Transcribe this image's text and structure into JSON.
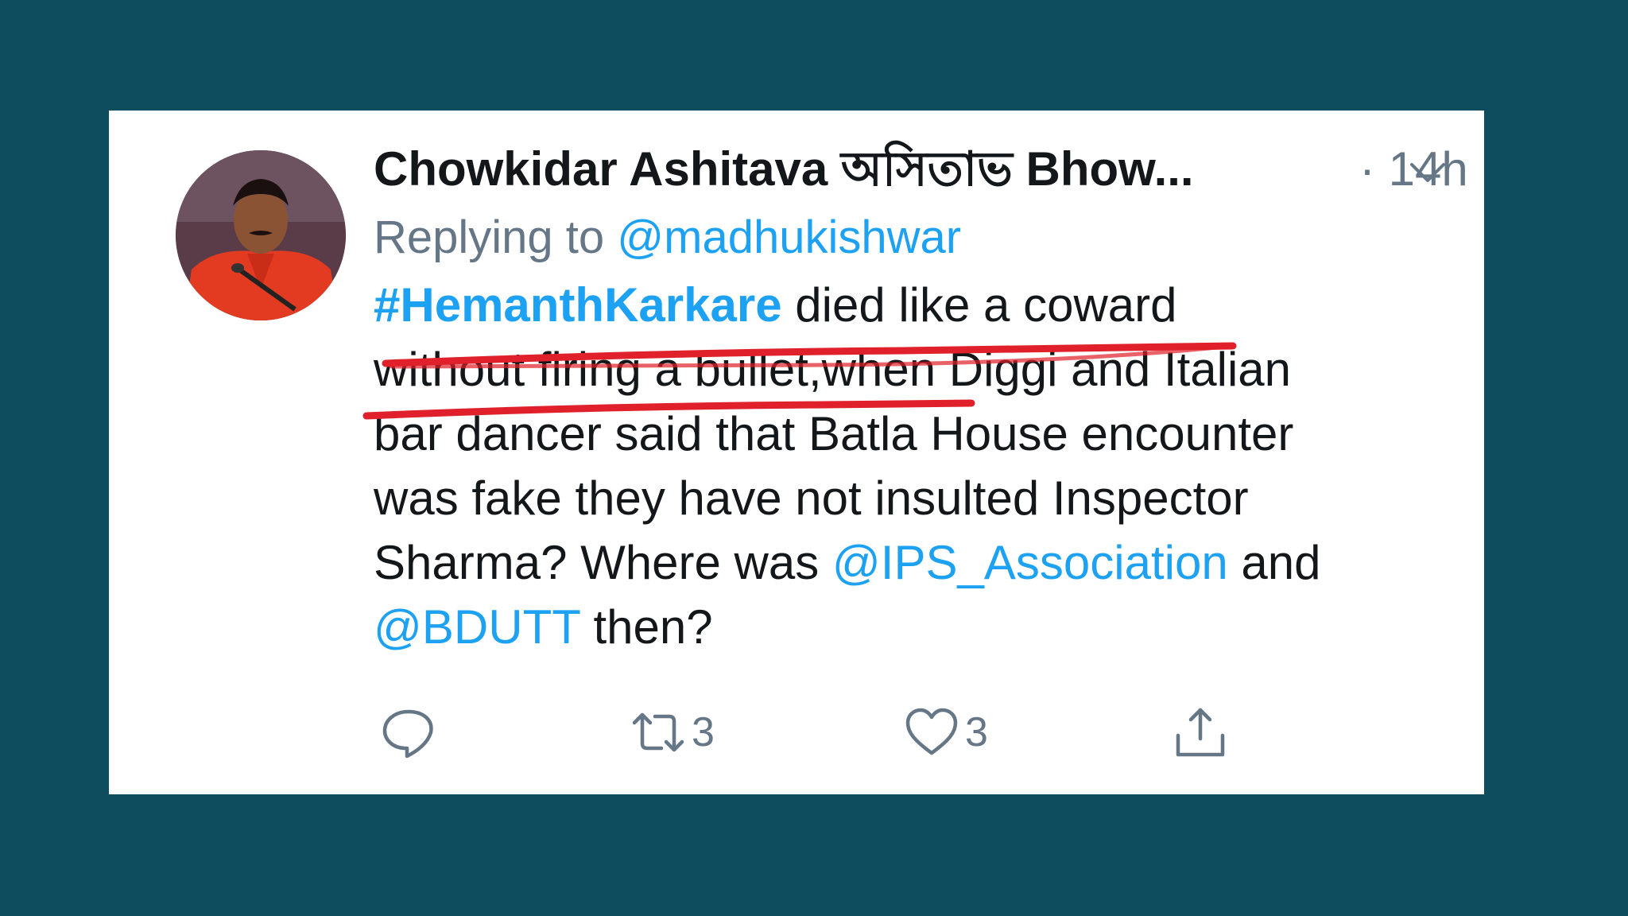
{
  "tweet": {
    "display_name": "Chowkidar Ashitava অসিতাভ Bhow...",
    "time": "· 14h",
    "replying_prefix": "Replying to ",
    "replying_handle": "@madhukishwar",
    "line1_hashtag": "#HemanthKarkare",
    "line1_rest": " died like a coward",
    "line2": "without firing a bullet,when Diggi and Italian",
    "line3": "bar dancer said that Batla House encounter",
    "line4": "was fake they have not insulted Inspector",
    "line5_start": "Sharma? Where was ",
    "line5_mention": "@IPS_Association",
    "line5_end": " and",
    "line6_mention": "@BDUTT",
    "line6_end": " then?"
  },
  "actions": {
    "reply_icon": "reply-icon",
    "retweet_icon": "retweet-icon",
    "retweet_count": "3",
    "like_icon": "heart-icon",
    "like_count": "3",
    "share_icon": "share-icon"
  },
  "colors": {
    "background": "#0e4d5e",
    "card": "#ffffff",
    "link": "#1da1f2",
    "text": "#14171a",
    "secondary": "#657786",
    "underline": "#e0202a"
  }
}
